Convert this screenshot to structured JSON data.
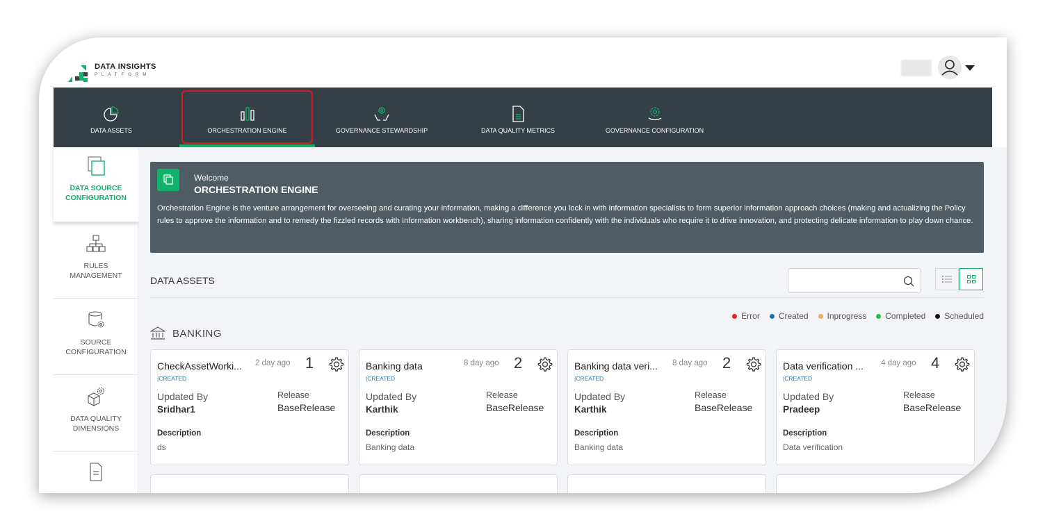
{
  "brand": {
    "title": "DATA INSIGHTS",
    "subtitle": "PLATFORM"
  },
  "nav": {
    "tabs": [
      {
        "label": "DATA ASSETS",
        "icon": "pie-chart-icon"
      },
      {
        "label": "ORCHESTRATION ENGINE",
        "icon": "bar-chart-icon",
        "active": true
      },
      {
        "label": "GOVERNANCE STEWARDSHIP",
        "icon": "hands-gear-icon"
      },
      {
        "label": "DATA QUALITY METRICS",
        "icon": "document-icon"
      },
      {
        "label": "GOVERNANCE CONFIGURATION",
        "icon": "hand-gear-icon"
      }
    ]
  },
  "sidebar": {
    "items": [
      {
        "label": "DATA SOURCE CONFIGURATION",
        "icon": "copy-icon",
        "active": true
      },
      {
        "label": "RULES MANAGEMENT",
        "icon": "hierarchy-icon"
      },
      {
        "label": "SOURCE CONFIGURATION",
        "icon": "database-gear-icon"
      },
      {
        "label": "DATA QUALITY DIMENSIONS",
        "icon": "cube-gear-icon"
      },
      {
        "label": "",
        "icon": "document-icon"
      }
    ]
  },
  "banner": {
    "welcome": "Welcome",
    "title": "ORCHESTRATION ENGINE",
    "description": "Orchestration Engine is the venture arrangement for overseeing and curating your information, making a difference you lock in with information specialists to form superior information approach choices (making and actualizing the Policy rules to approve the information and to remedy the fizzled records with Information workbench), sharing information confidently with the individuals who require it to drive innovation, and protecting delicate information to play down chance."
  },
  "section": {
    "title": "DATA ASSETS"
  },
  "search": {
    "placeholder": "",
    "value": ""
  },
  "legend": [
    {
      "label": "Error",
      "color": "#e8212b"
    },
    {
      "label": "Created",
      "color": "#1a6fb5"
    },
    {
      "label": "Inprogress",
      "color": "#f5a95b"
    },
    {
      "label": "Completed",
      "color": "#3cb54a"
    },
    {
      "label": "Scheduled",
      "color": "#111111"
    }
  ],
  "group": {
    "title": "BANKING",
    "icon": "bank-icon"
  },
  "labels": {
    "updated_by": "Updated By",
    "release": "Release",
    "description": "Description"
  },
  "cards": [
    {
      "name": "CheckAssetWorki...",
      "status": "|CREATED",
      "time": "2 day ago",
      "count": "1",
      "updated_by": "Sridhar1",
      "release": "BaseRelease",
      "description": "ds"
    },
    {
      "name": "Banking data",
      "status": "|CREATED",
      "time": "8 day ago",
      "count": "2",
      "updated_by": "Karthik",
      "release": "BaseRelease",
      "description": "Banking data"
    },
    {
      "name": "Banking data veri...",
      "status": "|CREATED",
      "time": "8 day ago",
      "count": "2",
      "updated_by": "Karthik",
      "release": "BaseRelease",
      "description": "Banking data"
    },
    {
      "name": "Data verification ...",
      "status": "|CREATED",
      "time": "4 day ago",
      "count": "4",
      "updated_by": "Pradeep",
      "release": "BaseRelease",
      "description": "Data verification"
    }
  ],
  "colors": {
    "accent": "#13b26b",
    "nav_bg": "#343f46",
    "banner_bg": "#4f5c63",
    "highlight": "#d81b26",
    "status_created": "#1a7fc1"
  }
}
